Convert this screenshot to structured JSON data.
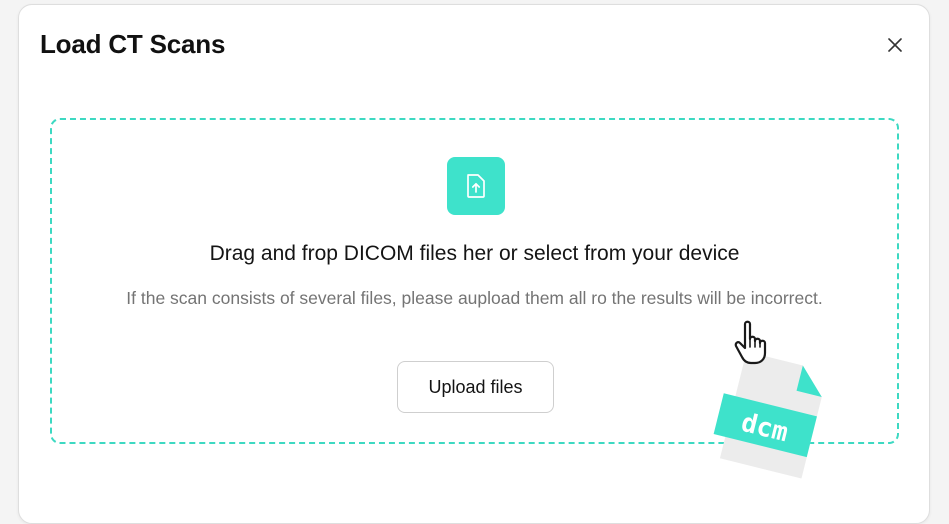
{
  "modal": {
    "title": "Load CT Scans",
    "close_icon": "close-icon"
  },
  "dropzone": {
    "icon": "file-upload-icon",
    "heading": "Drag and frop DICOM files her or select from your device",
    "subtext": "If the scan consists of several files, please aupload them all ro the results will be incorrect.",
    "upload_button_label": "Upload files",
    "illustration_label": "dcm",
    "illustration_icon": "dcm-file-icon",
    "cursor_icon": "hand-pointer-icon"
  },
  "colors": {
    "accent": "#3ee2cb",
    "dashed_border": "#3dd9c2",
    "text_primary": "#141414",
    "text_secondary": "#747474"
  }
}
